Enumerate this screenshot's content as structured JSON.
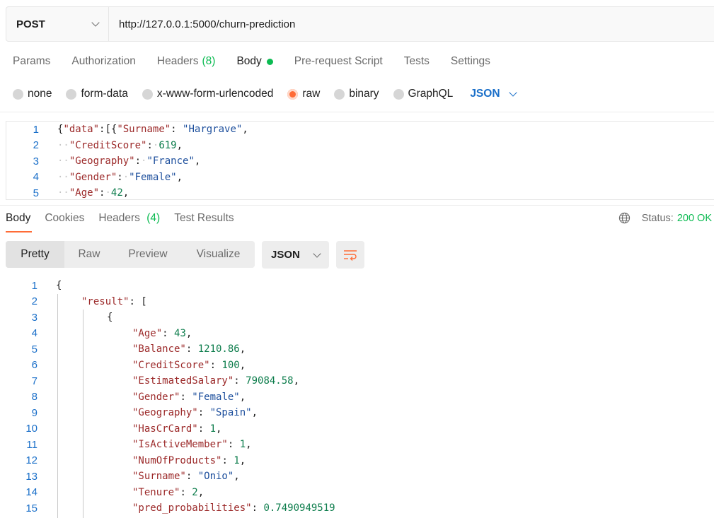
{
  "request": {
    "method": "POST",
    "url": "http://127.0.0.1:5000/churn-prediction"
  },
  "request_tabs": [
    {
      "label": "Params"
    },
    {
      "label": "Authorization"
    },
    {
      "label": "Headers",
      "count": "(8)"
    },
    {
      "label": "Body"
    },
    {
      "label": "Pre-request Script"
    },
    {
      "label": "Tests"
    },
    {
      "label": "Settings"
    }
  ],
  "body_types": {
    "options": [
      "none",
      "form-data",
      "x-www-form-urlencoded",
      "raw",
      "binary",
      "GraphQL"
    ],
    "selected": "raw",
    "format": "JSON"
  },
  "request_body": {
    "line_numbers": [
      "1",
      "2",
      "3",
      "4",
      "5"
    ],
    "lines": [
      [
        [
          "p",
          "{"
        ],
        [
          "k",
          "\"data\""
        ],
        [
          "p",
          ":[{"
        ],
        [
          "k",
          "\"Surname\""
        ],
        [
          "p",
          ": "
        ],
        [
          "s",
          "\"Hargrave\""
        ],
        [
          "p",
          ","
        ]
      ],
      [
        [
          "ws",
          "··"
        ],
        [
          "k",
          "\"CreditScore\""
        ],
        [
          "p",
          ":"
        ],
        [
          "ws",
          "·"
        ],
        [
          "n",
          "619"
        ],
        [
          "p",
          ","
        ]
      ],
      [
        [
          "ws",
          "··"
        ],
        [
          "k",
          "\"Geography\""
        ],
        [
          "p",
          ":"
        ],
        [
          "ws",
          "·"
        ],
        [
          "s",
          "\"France\""
        ],
        [
          "p",
          ","
        ]
      ],
      [
        [
          "ws",
          "··"
        ],
        [
          "k",
          "\"Gender\""
        ],
        [
          "p",
          ":"
        ],
        [
          "ws",
          "·"
        ],
        [
          "s",
          "\"Female\""
        ],
        [
          "p",
          ","
        ]
      ],
      [
        [
          "ws",
          "··"
        ],
        [
          "k",
          "\"Age\""
        ],
        [
          "p",
          ":"
        ],
        [
          "ws",
          "·"
        ],
        [
          "n",
          "42"
        ],
        [
          "p",
          ","
        ]
      ]
    ]
  },
  "response_tabs": [
    {
      "label": "Body"
    },
    {
      "label": "Cookies"
    },
    {
      "label": "Headers",
      "count": "(4)"
    },
    {
      "label": "Test Results"
    }
  ],
  "status": {
    "label": "Status:",
    "value": "200 OK",
    "icon": "globe-icon"
  },
  "view_modes": [
    "Pretty",
    "Raw",
    "Preview",
    "Visualize"
  ],
  "response_format": "JSON",
  "response_body": {
    "line_numbers": [
      "1",
      "2",
      "3",
      "4",
      "5",
      "6",
      "7",
      "8",
      "9",
      "10",
      "11",
      "12",
      "13",
      "14",
      "15"
    ],
    "lines": [
      {
        "indent": 0,
        "tokens": [
          [
            "p",
            "{"
          ]
        ]
      },
      {
        "indent": 1,
        "tokens": [
          [
            "k",
            "\"result\""
          ],
          [
            "p",
            ": ["
          ]
        ]
      },
      {
        "indent": 2,
        "tokens": [
          [
            "p",
            "{"
          ]
        ]
      },
      {
        "indent": 3,
        "tokens": [
          [
            "k",
            "\"Age\""
          ],
          [
            "p",
            ": "
          ],
          [
            "n",
            "43"
          ],
          [
            "p",
            ","
          ]
        ]
      },
      {
        "indent": 3,
        "tokens": [
          [
            "k",
            "\"Balance\""
          ],
          [
            "p",
            ": "
          ],
          [
            "n",
            "1210.86"
          ],
          [
            "p",
            ","
          ]
        ]
      },
      {
        "indent": 3,
        "tokens": [
          [
            "k",
            "\"CreditScore\""
          ],
          [
            "p",
            ": "
          ],
          [
            "n",
            "100"
          ],
          [
            "p",
            ","
          ]
        ]
      },
      {
        "indent": 3,
        "tokens": [
          [
            "k",
            "\"EstimatedSalary\""
          ],
          [
            "p",
            ": "
          ],
          [
            "n",
            "79084.58"
          ],
          [
            "p",
            ","
          ]
        ]
      },
      {
        "indent": 3,
        "tokens": [
          [
            "k",
            "\"Gender\""
          ],
          [
            "p",
            ": "
          ],
          [
            "s",
            "\"Female\""
          ],
          [
            "p",
            ","
          ]
        ]
      },
      {
        "indent": 3,
        "tokens": [
          [
            "k",
            "\"Geography\""
          ],
          [
            "p",
            ": "
          ],
          [
            "s",
            "\"Spain\""
          ],
          [
            "p",
            ","
          ]
        ]
      },
      {
        "indent": 3,
        "tokens": [
          [
            "k",
            "\"HasCrCard\""
          ],
          [
            "p",
            ": "
          ],
          [
            "n",
            "1"
          ],
          [
            "p",
            ","
          ]
        ]
      },
      {
        "indent": 3,
        "tokens": [
          [
            "k",
            "\"IsActiveMember\""
          ],
          [
            "p",
            ": "
          ],
          [
            "n",
            "1"
          ],
          [
            "p",
            ","
          ]
        ]
      },
      {
        "indent": 3,
        "tokens": [
          [
            "k",
            "\"NumOfProducts\""
          ],
          [
            "p",
            ": "
          ],
          [
            "n",
            "1"
          ],
          [
            "p",
            ","
          ]
        ]
      },
      {
        "indent": 3,
        "tokens": [
          [
            "k",
            "\"Surname\""
          ],
          [
            "p",
            ": "
          ],
          [
            "s",
            "\"Onio\""
          ],
          [
            "p",
            ","
          ]
        ]
      },
      {
        "indent": 3,
        "tokens": [
          [
            "k",
            "\"Tenure\""
          ],
          [
            "p",
            ": "
          ],
          [
            "n",
            "2"
          ],
          [
            "p",
            ","
          ]
        ]
      },
      {
        "indent": 3,
        "tokens": [
          [
            "k",
            "\"pred_probabilities\""
          ],
          [
            "p",
            ": "
          ],
          [
            "n",
            "0.7490949519"
          ]
        ]
      }
    ]
  }
}
